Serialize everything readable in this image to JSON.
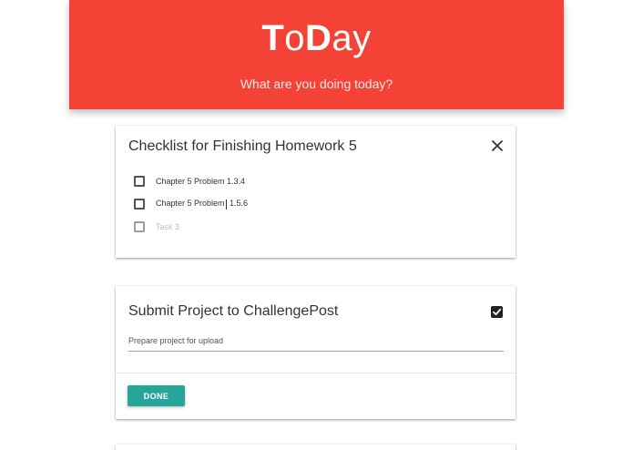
{
  "app": {
    "logo_parts": [
      "T",
      "o",
      "D",
      "ay"
    ],
    "tagline": "What are you doing today?"
  },
  "cards": [
    {
      "title": "Checklist for Finishing Homework 5",
      "close_icon": "close-icon",
      "tasks": [
        {
          "text_before_caret": "Chapter 5 Problem",
          "text_after_caret": " 1.3.4",
          "checked": false
        },
        {
          "text_before_caret": "Chapter 5 Problem",
          "text_after_caret": " 1.5.6",
          "checked": false
        },
        {
          "placeholder": "Task 3",
          "checked": false
        }
      ]
    },
    {
      "title": "Submit Project to ChallengePost",
      "completed": true,
      "description": "Prepare project for upload",
      "done_label": "DONE"
    }
  ],
  "colors": {
    "header_red": "#f44336",
    "accent_teal": "#26a69a"
  }
}
